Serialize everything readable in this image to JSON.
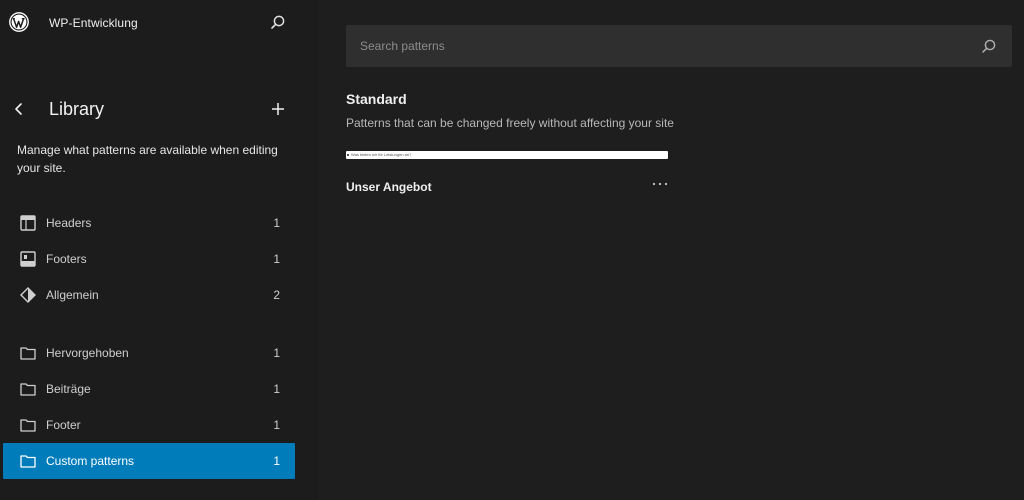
{
  "header": {
    "site_name": "WP-Entwicklung"
  },
  "library": {
    "title": "Library",
    "description": "Manage what patterns are available when editing your site."
  },
  "nav_items": [
    {
      "label": "Headers",
      "count": "1",
      "icon": "header-layout-icon"
    },
    {
      "label": "Footers",
      "count": "1",
      "icon": "footer-layout-icon"
    },
    {
      "label": "Allgemein",
      "count": "2",
      "icon": "symbol-diamond-icon"
    },
    {
      "label": "Hervorgehoben",
      "count": "1",
      "icon": "folder-icon"
    },
    {
      "label": "Beiträge",
      "count": "1",
      "icon": "folder-icon"
    },
    {
      "label": "Footer",
      "count": "1",
      "icon": "folder-icon"
    },
    {
      "label": "Custom patterns",
      "count": "1",
      "icon": "folder-icon",
      "active": true
    }
  ],
  "search": {
    "placeholder": "Search patterns",
    "value": ""
  },
  "section": {
    "title": "Standard",
    "description": "Patterns that can be changed freely without affecting your site"
  },
  "patterns": [
    {
      "name": "Unser Angebot",
      "preview_text": "Was bieten wir für Leistungen an?"
    }
  ],
  "colors": {
    "accent": "#007cba",
    "sidebar_bg": "#1c1c1c",
    "main_bg": "#1e1e1e",
    "input_bg": "#2f2f2f"
  }
}
